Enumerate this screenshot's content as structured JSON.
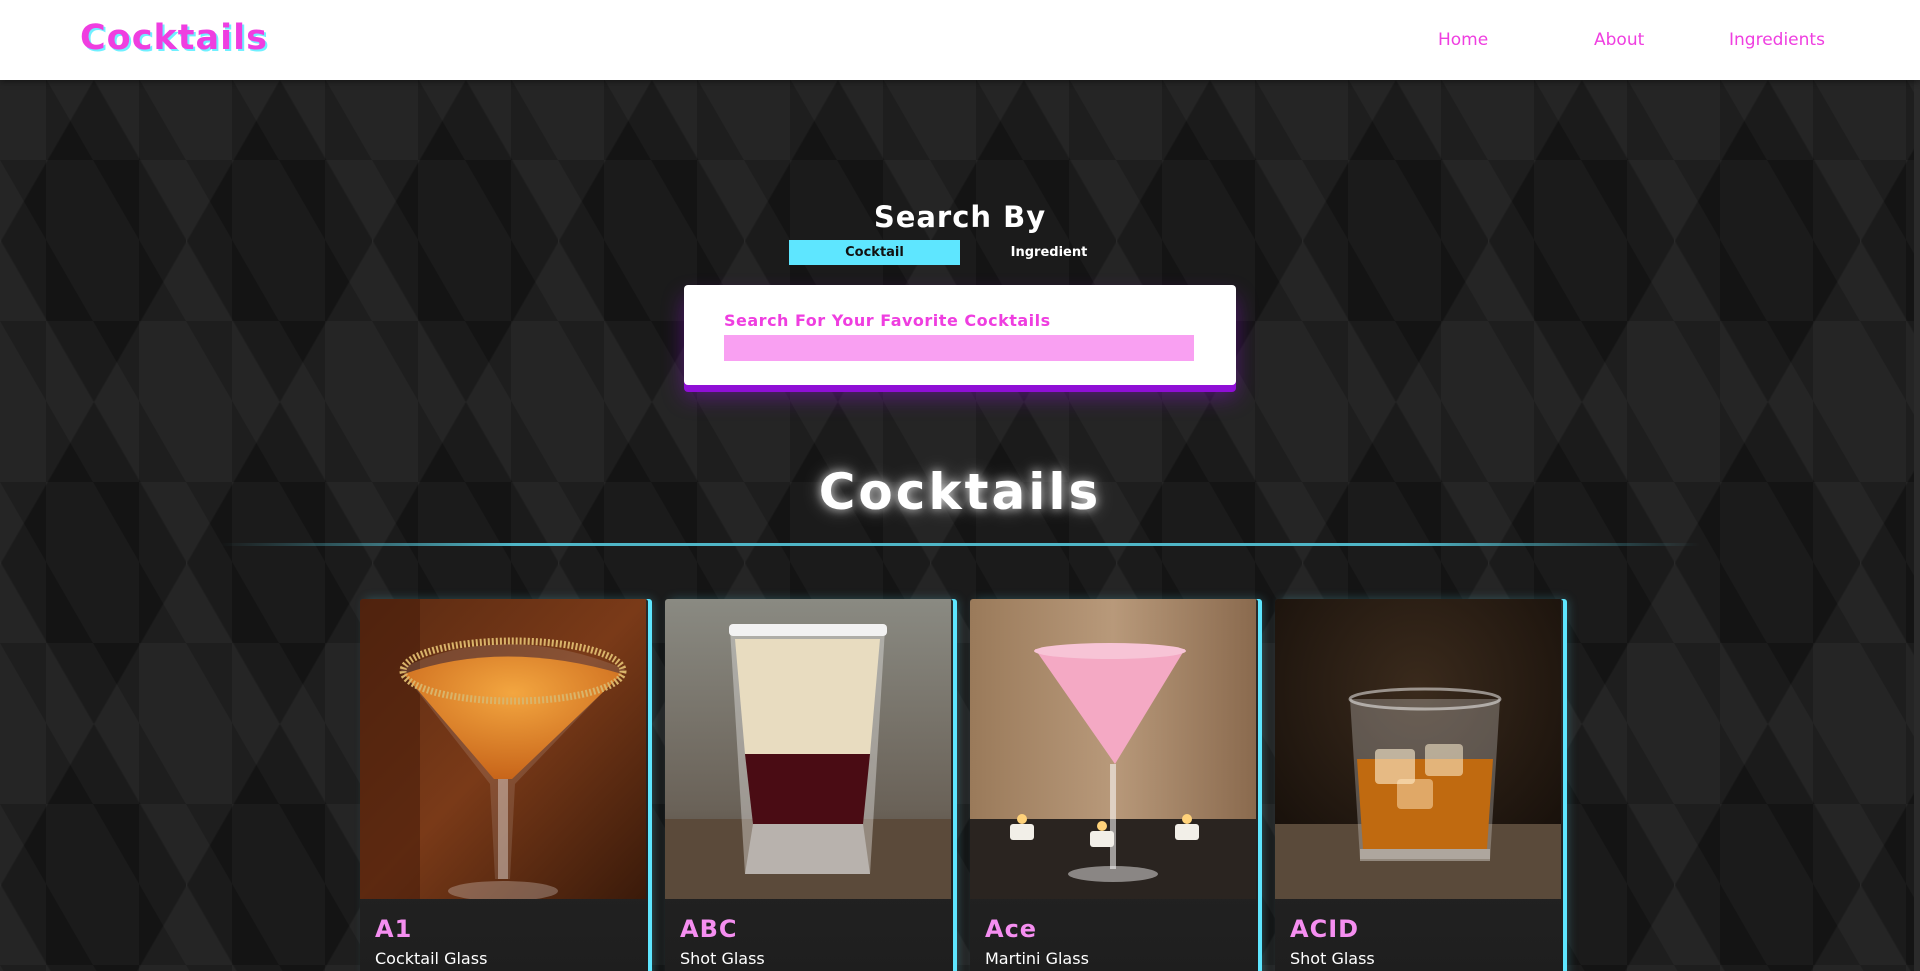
{
  "header": {
    "logo": "Cocktails",
    "nav": [
      {
        "label": "Home"
      },
      {
        "label": "About"
      },
      {
        "label": "Ingredients"
      }
    ]
  },
  "search": {
    "title": "Search By",
    "toggle_cocktail": "Cocktail",
    "toggle_ingredient": "Ingredient",
    "label": "Search For Your Favorite Cocktails",
    "value": "",
    "placeholder": ""
  },
  "section": {
    "title": "Cocktails"
  },
  "cocktails": [
    {
      "name": "A1",
      "glass": "Cocktail Glass"
    },
    {
      "name": "ABC",
      "glass": "Shot Glass"
    },
    {
      "name": "Ace",
      "glass": "Martini Glass"
    },
    {
      "name": "ACID",
      "glass": "Shot Glass"
    }
  ],
  "colors": {
    "accent_pink": "#ef3ee0",
    "accent_cyan": "#5ee6ff",
    "purple": "#8f0fd6"
  }
}
